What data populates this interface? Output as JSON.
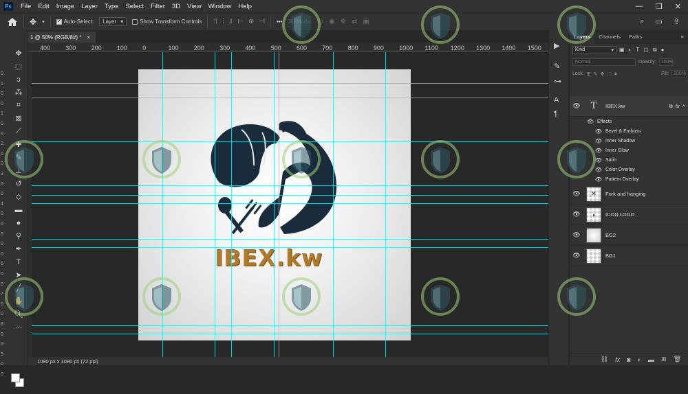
{
  "menubar": {
    "logo": "Ps",
    "items": [
      "File",
      "Edit",
      "Image",
      "Layer",
      "Type",
      "Select",
      "Filter",
      "3D",
      "View",
      "Window",
      "Help"
    ],
    "window_controls": [
      "—",
      "❐",
      "✕"
    ]
  },
  "options": {
    "auto_select_label": "Auto-Select:",
    "auto_select_target": "Layer",
    "show_transform_label": "Show Transform Controls",
    "more": "•••",
    "mode_3d_label": "3D Mode:"
  },
  "doc_tab": {
    "title": "1 @ 50% (RGB/8#) *",
    "close": "×"
  },
  "ruler": {
    "h_ticks": [
      "400",
      "300",
      "200",
      "100",
      "0",
      "100",
      "200",
      "300",
      "400",
      "500",
      "600",
      "700",
      "800",
      "900",
      "1000",
      "1100",
      "1200",
      "1300",
      "1400",
      "1500"
    ],
    "v_ticks": [
      "0",
      "1",
      "0",
      "0",
      "1",
      "0",
      "0",
      "2",
      "0",
      "0",
      "3",
      "0",
      "0",
      "4",
      "0",
      "0",
      "5",
      "0",
      "0",
      "6",
      "0",
      "0",
      "7",
      "0",
      "0",
      "8",
      "0",
      "0",
      "9",
      "0",
      "0"
    ]
  },
  "canvas": {
    "brand_text": "IBEX.kw",
    "accent_color": "#34e0e6",
    "logo_color": "#1a2b3c"
  },
  "status": {
    "doc_size": "1080 px x 1080 px (72 ppi)"
  },
  "layers_panel": {
    "tabs": [
      "Layers",
      "Channels",
      "Paths"
    ],
    "kind_label": "Kind",
    "blend_mode": "Normal",
    "opacity_label": "Opacity:",
    "opacity_value": "100%",
    "lock_label": "Lock:",
    "fill_label": "Fill:",
    "fill_value": "100%",
    "text_layer": {
      "name": "IBEX.kw",
      "fx": "fx"
    },
    "effects_label": "Effects",
    "effects": [
      "Bevel & Emboss",
      "Inner Shadow",
      "Inner Glow",
      "Satin",
      "Color Overlay",
      "Pattern Overlay"
    ],
    "layers": [
      "Fork and hanging",
      "ICON LOGO",
      "BG2",
      "BG1"
    ]
  }
}
